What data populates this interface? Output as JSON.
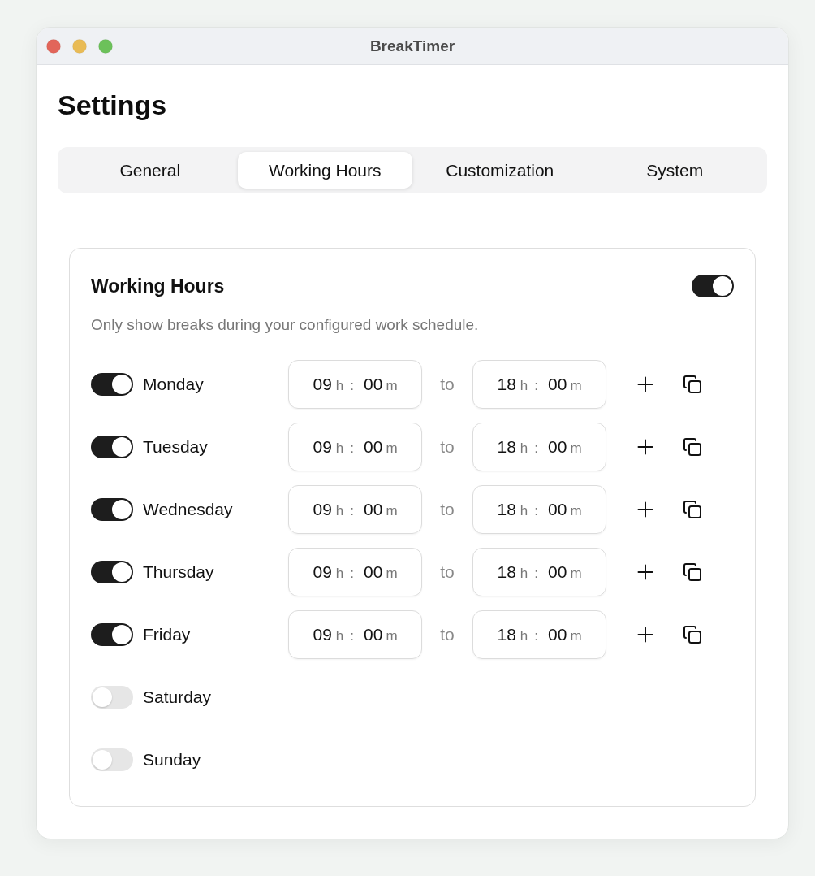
{
  "window": {
    "title": "BreakTimer"
  },
  "page_title": "Settings",
  "tabs": [
    {
      "label": "General",
      "selected": false
    },
    {
      "label": "Working Hours",
      "selected": true
    },
    {
      "label": "Customization",
      "selected": false
    },
    {
      "label": "System",
      "selected": false
    }
  ],
  "working_hours": {
    "title": "Working Hours",
    "on": true,
    "description": "Only show breaks during your configured work schedule.",
    "days": [
      {
        "name": "Monday",
        "on": true,
        "start": {
          "hour": "09",
          "hour_unit": "h",
          "separator": ":",
          "minute": "00",
          "minute_unit": "m"
        },
        "to": "to",
        "end": {
          "hour": "18",
          "hour_unit": "h",
          "separator": ":",
          "minute": "00",
          "minute_unit": "m"
        }
      },
      {
        "name": "Tuesday",
        "on": true,
        "start": {
          "hour": "09",
          "hour_unit": "h",
          "separator": ":",
          "minute": "00",
          "minute_unit": "m"
        },
        "to": "to",
        "end": {
          "hour": "18",
          "hour_unit": "h",
          "separator": ":",
          "minute": "00",
          "minute_unit": "m"
        }
      },
      {
        "name": "Wednesday",
        "on": true,
        "start": {
          "hour": "09",
          "hour_unit": "h",
          "separator": ":",
          "minute": "00",
          "minute_unit": "m"
        },
        "to": "to",
        "end": {
          "hour": "18",
          "hour_unit": "h",
          "separator": ":",
          "minute": "00",
          "minute_unit": "m"
        }
      },
      {
        "name": "Thursday",
        "on": true,
        "start": {
          "hour": "09",
          "hour_unit": "h",
          "separator": ":",
          "minute": "00",
          "minute_unit": "m"
        },
        "to": "to",
        "end": {
          "hour": "18",
          "hour_unit": "h",
          "separator": ":",
          "minute": "00",
          "minute_unit": "m"
        }
      },
      {
        "name": "Friday",
        "on": true,
        "start": {
          "hour": "09",
          "hour_unit": "h",
          "separator": ":",
          "minute": "00",
          "minute_unit": "m"
        },
        "to": "to",
        "end": {
          "hour": "18",
          "hour_unit": "h",
          "separator": ":",
          "minute": "00",
          "minute_unit": "m"
        }
      },
      {
        "name": "Saturday",
        "on": false
      },
      {
        "name": "Sunday",
        "on": false
      }
    ]
  }
}
